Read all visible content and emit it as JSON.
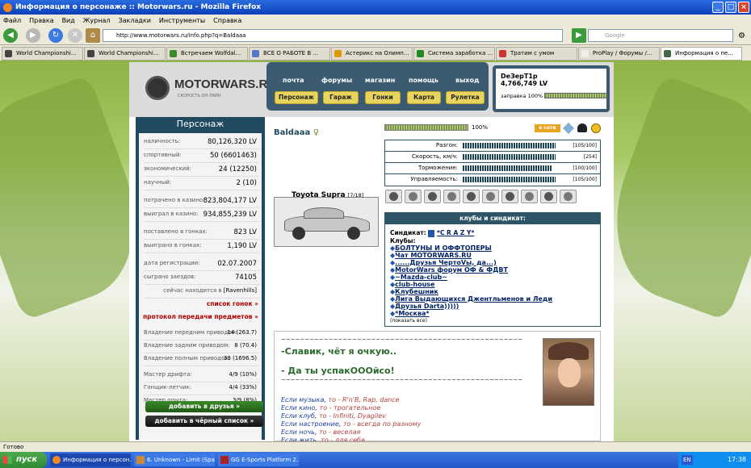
{
  "window": {
    "title": "Информация о персонаже :: Motorwars.ru - Mozilla Firefox"
  },
  "menu": [
    "Файл",
    "Правка",
    "Вид",
    "Журнал",
    "Закладки",
    "Инструменты",
    "Справка"
  ],
  "url": "http://www.motorwars.ru/info.php?q=Baldaaa",
  "search_placeholder": "Google",
  "tabs": [
    {
      "label": "World Championshi...",
      "color": "#444444"
    },
    {
      "label": "World Championshi...",
      "color": "#444444"
    },
    {
      "label": "Встречаем Wolfdal...",
      "color": "#3a8a2a"
    },
    {
      "label": "ВСЕ О РАБОТЕ В ...",
      "color": "#5577cc"
    },
    {
      "label": "Астерикс на Олимп...",
      "color": "#dd9900"
    },
    {
      "label": "Система заработка ...",
      "color": "#228822"
    },
    {
      "label": "Тратим с умом",
      "color": "#cc3333"
    },
    {
      "label": "ProPlay / Форумы /...",
      "color": "#eeeeee"
    },
    {
      "label": "Информация о пе...",
      "color": "#446644"
    }
  ],
  "site": {
    "logo": "MOTORWARS.RU",
    "tagline": "СКОРОСТЬ ОН-ЛАЙН",
    "top_menu": [
      "почта",
      "форумы",
      "магазин",
      "помощь",
      "выход"
    ],
    "sub_menu": [
      "Персонаж",
      "Гараж",
      "Гонки",
      "Карта",
      "Рулетка"
    ],
    "user": {
      "name": "DeЗерТ1р",
      "money": "4,766,749 LV",
      "fuel_label": "заправка 100%",
      "fuel_pct": 100
    }
  },
  "character": {
    "header": "Персонаж",
    "rows": [
      {
        "label": "наличность:",
        "value": "80,126,320 LV"
      },
      {
        "label": "спортивный:",
        "value": "50 (6601463)"
      },
      {
        "label": "экономический:",
        "value": "24 (12250)"
      },
      {
        "label": "научный:",
        "value": "2 (10)"
      },
      {
        "label": "потрачено в казино:",
        "value": "823,804,177 LV"
      },
      {
        "label": "выиграл в казино:",
        "value": "934,855,239 LV"
      },
      {
        "label": "поставлено в гонках:",
        "value": "823 LV"
      },
      {
        "label": "выиграно в гонках:",
        "value": "1,190 LV"
      },
      {
        "label": "дата регистрации:",
        "value": "02.07.2007"
      },
      {
        "label": "сыграно заездов:",
        "value": "74105"
      }
    ],
    "location_prefix": "сейчас находится в",
    "location": "[Ravenhills]",
    "link_races": "список гонок »",
    "link_transfers": "протокол передачи предметов »",
    "skills": [
      {
        "label": "Владение передним приводом:",
        "value": "14 (263.7)"
      },
      {
        "label": "Владение задним приводом:",
        "value": "8 (70.4)"
      },
      {
        "label": "Владение полным приводом:",
        "value": "33 (1696.5)"
      }
    ],
    "skills2": [
      {
        "label": "Мастер дрифта:",
        "value": "4/9 (10%)"
      },
      {
        "label": "Гонщик-летчик:",
        "value": "4/4 (33%)"
      },
      {
        "label": "Мастер опыта:",
        "value": "3/9 (8%)"
      }
    ],
    "btn_friend": "добавить в друзья »",
    "btn_black": "добавить в чёрный список »"
  },
  "profile": {
    "name": "Baldaaa",
    "gender_symbol": "♀",
    "progress_label": "100%",
    "progress_pct": 100,
    "online_badge": "в сети",
    "car_name": "Toyota Supra",
    "car_count": "[7/18]",
    "stats": [
      {
        "label": "Разгон:",
        "num": "[105/100]",
        "pct": 0.96
      },
      {
        "label": "Скорость, км/ч:",
        "num": "[254]",
        "pct": 0.96
      },
      {
        "label": "Торможение:",
        "num": "[100/100]",
        "pct": 0.92
      },
      {
        "label": "Управляемость:",
        "num": "[105/100]",
        "pct": 0.96
      }
    ],
    "clubs_header": "клубы и синдикат:",
    "syndicate_label": "Синдикат:",
    "syndicate": "*C R A Z Y*",
    "clubs_label": "Клубы:",
    "clubs": [
      "БОЛТУНЫ И ОФФТОПЕРЫ",
      "Чат MOTORWARS.RU",
      "......Друзья ЧертоVы, да...)",
      "MotorWars форум ОФ & ФДВТ",
      "~Mazda-club~",
      "club-house",
      "Клубешник",
      "Лига Выдающихся Джентльменов и Леди",
      "Друзья Darta)))))",
      "*Москва*"
    ],
    "show_all": "(показать все)",
    "about": {
      "sep": "~~~~~~~~~~~~~~~~~~~~~~~~~~~~~~~~~~~~~~~~~~~~~~~~~~~~~~~",
      "line1": "-Славик, чёт я очкую..",
      "line2": "- Да ты успакОООйсо!",
      "likes": [
        {
          "k": "Если музыка,",
          "v": " то - R'n'B, Rap, dance"
        },
        {
          "k": "Если кино,",
          "v": " то - трогательное"
        },
        {
          "k": "Если клуб,",
          "v": " то - Infiniti, Dyagilev"
        },
        {
          "k": "Если настроение,",
          "v": " то - всегда по разному"
        },
        {
          "k": "Если ночь,",
          "v": " то - веселая"
        },
        {
          "k": "Если жить,",
          "v": " то - для себя"
        }
      ]
    }
  },
  "status": "Готово",
  "taskbar": {
    "start": "пуск",
    "items": [
      "Информация о персон...",
      "6. Unknown - Limit (Spa...",
      "GG E-Sports Platform 2.2"
    ],
    "lang": "EN",
    "time": "17:38"
  }
}
